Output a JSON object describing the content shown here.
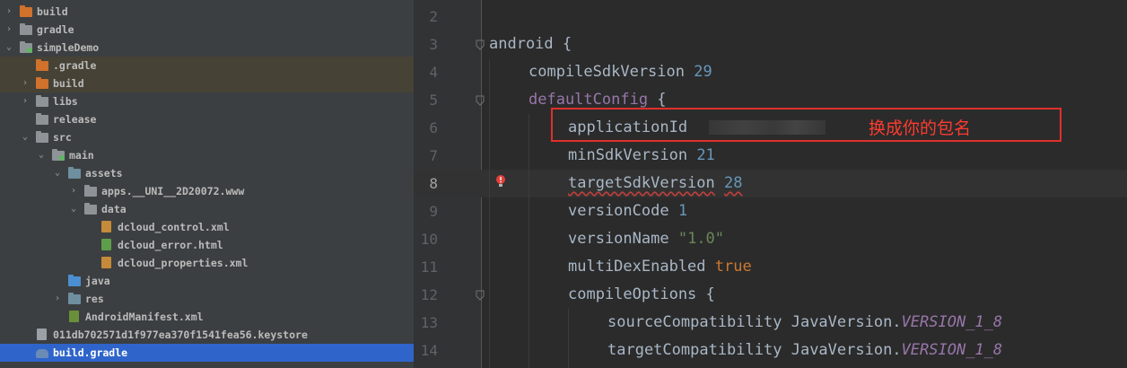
{
  "project_tree": {
    "items": [
      {
        "label": "build",
        "arrow": "›",
        "icon": "folder-orange-icon"
      },
      {
        "label": "gradle",
        "arrow": "›",
        "icon": "folder-gray-icon"
      },
      {
        "label": "simpleDemo",
        "arrow": "⌄",
        "icon": "module-folder-icon"
      },
      {
        "label": ".gradle",
        "arrow": "",
        "icon": "folder-orange-icon"
      },
      {
        "label": "build",
        "arrow": "›",
        "icon": "folder-orange-icon"
      },
      {
        "label": "libs",
        "arrow": "›",
        "icon": "folder-gray-icon"
      },
      {
        "label": "release",
        "arrow": "",
        "icon": "folder-gray-icon"
      },
      {
        "label": "src",
        "arrow": "⌄",
        "icon": "folder-gray-icon"
      },
      {
        "label": "main",
        "arrow": "⌄",
        "icon": "folder-source-icon"
      },
      {
        "label": "assets",
        "arrow": "⌄",
        "icon": "folder-resources-icon"
      },
      {
        "label": "apps.__UNI__2D20072.www",
        "arrow": "›",
        "icon": "folder-gray-icon"
      },
      {
        "label": "data",
        "arrow": "⌄",
        "icon": "folder-gray-icon"
      },
      {
        "label": "dcloud_control.xml",
        "arrow": "",
        "icon": "xml-file-icon"
      },
      {
        "label": "dcloud_error.html",
        "arrow": "",
        "icon": "html-file-icon"
      },
      {
        "label": "dcloud_properties.xml",
        "arrow": "",
        "icon": "xml-file-icon"
      },
      {
        "label": "java",
        "arrow": "",
        "icon": "folder-blue-icon"
      },
      {
        "label": "res",
        "arrow": "›",
        "icon": "folder-resources-icon"
      },
      {
        "label": "AndroidManifest.xml",
        "arrow": "",
        "icon": "manifest-file-icon"
      },
      {
        "label": "011db702571d1f977ea370f1541fea56.keystore",
        "arrow": "",
        "icon": "keystore-file-icon"
      },
      {
        "label": "build.gradle",
        "arrow": "",
        "icon": "gradle-file-icon"
      }
    ]
  },
  "editor": {
    "line_numbers": [
      "2",
      "3",
      "4",
      "5",
      "6",
      "7",
      "8",
      "9",
      "10",
      "11",
      "12",
      "13",
      "14"
    ],
    "active_line": "8",
    "code": {
      "l3_kw": "android",
      "l3_brace": " {",
      "l4_prop": "compileSdkVersion",
      "l4_val": "29",
      "l5_prop": "defaultConfig",
      "l5_brace": " {",
      "l6_prop": "applicationId",
      "l7_prop": "minSdkVersion",
      "l7_val": "21",
      "l8_prop": "targetSdkVersion",
      "l8_val": "28",
      "l9_prop": "versionCode",
      "l9_val": "1",
      "l10_prop": "versionName",
      "l10_val": "\"1.0\"",
      "l11_prop": "multiDexEnabled",
      "l11_val": "true",
      "l12_prop": "compileOptions",
      "l12_brace": " {",
      "l13_prop": "sourceCompatibility",
      "l13_cls": "JavaVersion.",
      "l13_const": "VERSION_1_8",
      "l14_prop": "targetCompatibility",
      "l14_cls": "JavaVersion.",
      "l14_const": "VERSION_1_8"
    },
    "annotation": "换成你的包名",
    "warning_icon": "warning-bulb-icon"
  },
  "colors": {
    "annotation_red": "#ff3b2f",
    "selection_blue": "#2f65ca",
    "number_blue": "#6897bb",
    "keyword_orange": "#cc7832",
    "string_green": "#6a8759",
    "constant_purple": "#9876aa"
  }
}
